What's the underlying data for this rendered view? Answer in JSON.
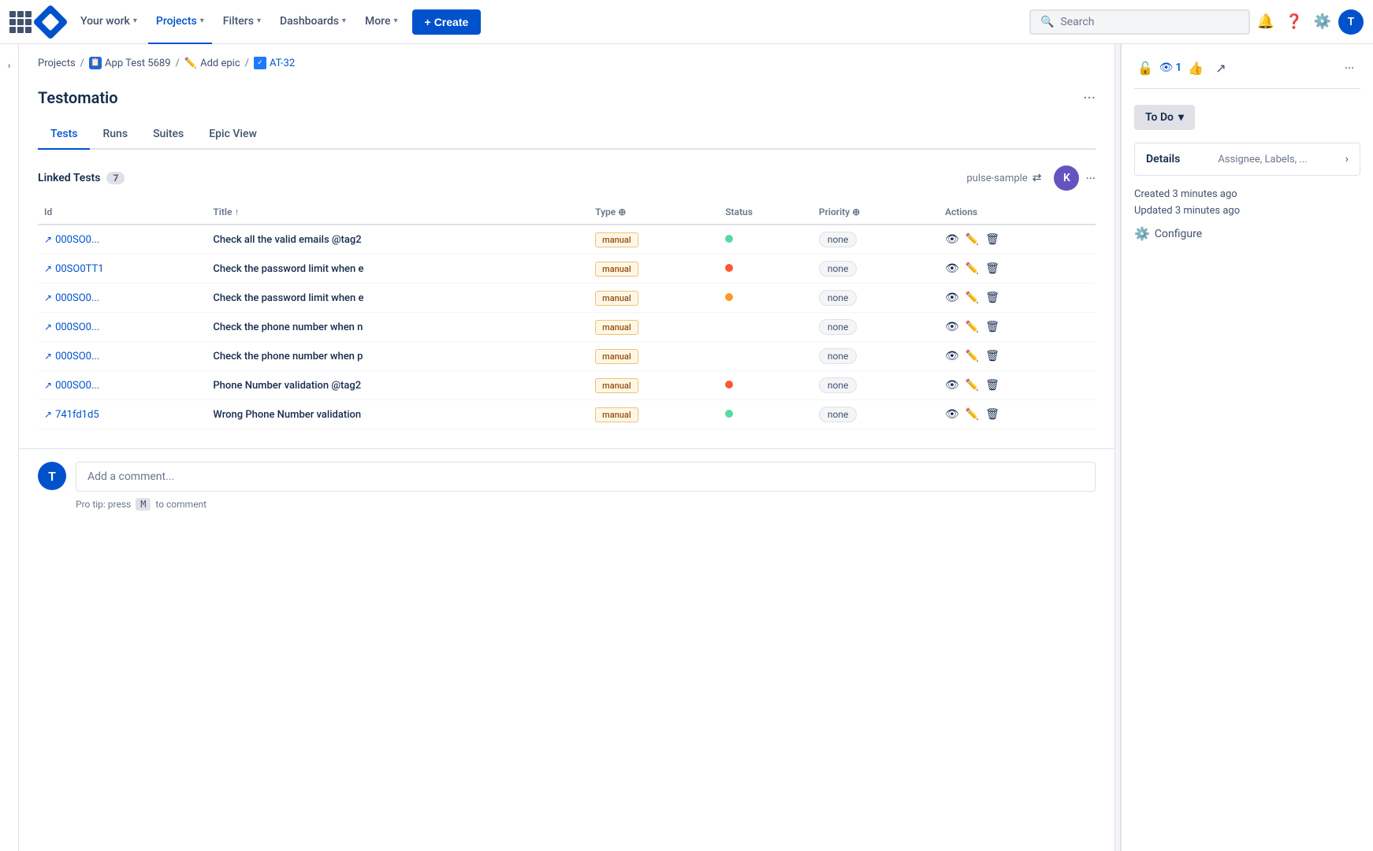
{
  "topnav": {
    "your_work_label": "Your work",
    "projects_label": "Projects",
    "filters_label": "Filters",
    "dashboards_label": "Dashboards",
    "more_label": "More",
    "create_label": "+",
    "search_placeholder": "Search",
    "user_initial": "T"
  },
  "breadcrumb": {
    "projects": "Projects",
    "project_name": "App Test 5689",
    "add_epic": "Add epic",
    "ticket_id": "AT-32"
  },
  "section": {
    "title": "Testomatio",
    "tabs": [
      "Tests",
      "Runs",
      "Suites",
      "Epic View"
    ],
    "active_tab": "Tests"
  },
  "linked_tests": {
    "title": "Linked Tests",
    "count": 7,
    "pulse_sample": "pulse-sample",
    "avatar_initial": "K"
  },
  "table": {
    "headers": [
      "Id",
      "Title",
      "Type",
      "Status",
      "Priority",
      "Actions"
    ],
    "rows": [
      {
        "id": "000SO0...",
        "title": "Check all the valid emails @tag2",
        "type": "manual",
        "status": "green",
        "priority": "none"
      },
      {
        "id": "00SO0TT1",
        "title": "Check the password limit when e",
        "type": "manual",
        "status": "red",
        "priority": "none"
      },
      {
        "id": "000SO0...",
        "title": "Check the password limit when e",
        "type": "manual",
        "status": "orange",
        "priority": "none"
      },
      {
        "id": "000SO0...",
        "title": "Check the phone number when n",
        "type": "manual",
        "status": "empty",
        "priority": "none"
      },
      {
        "id": "000SO0...",
        "title": "Check the phone number when p",
        "type": "manual",
        "status": "empty",
        "priority": "none"
      },
      {
        "id": "000SO0...",
        "title": "Phone Number validation @tag2",
        "type": "manual",
        "status": "red",
        "priority": "none"
      },
      {
        "id": "741fd1d5",
        "title": "Wrong Phone Number validation",
        "type": "manual",
        "status": "green",
        "priority": "none"
      }
    ]
  },
  "comment": {
    "placeholder": "Add a comment...",
    "user_initial": "T",
    "pro_tip": "Pro tip: press",
    "key": "M",
    "pro_tip_suffix": "to comment"
  },
  "right_panel": {
    "status_label": "To Do",
    "details_label": "Details",
    "details_sublabel": "Assignee, Labels, ...",
    "created_label": "Created 3 minutes ago",
    "updated_label": "Updated 3 minutes ago",
    "configure_label": "Configure"
  }
}
